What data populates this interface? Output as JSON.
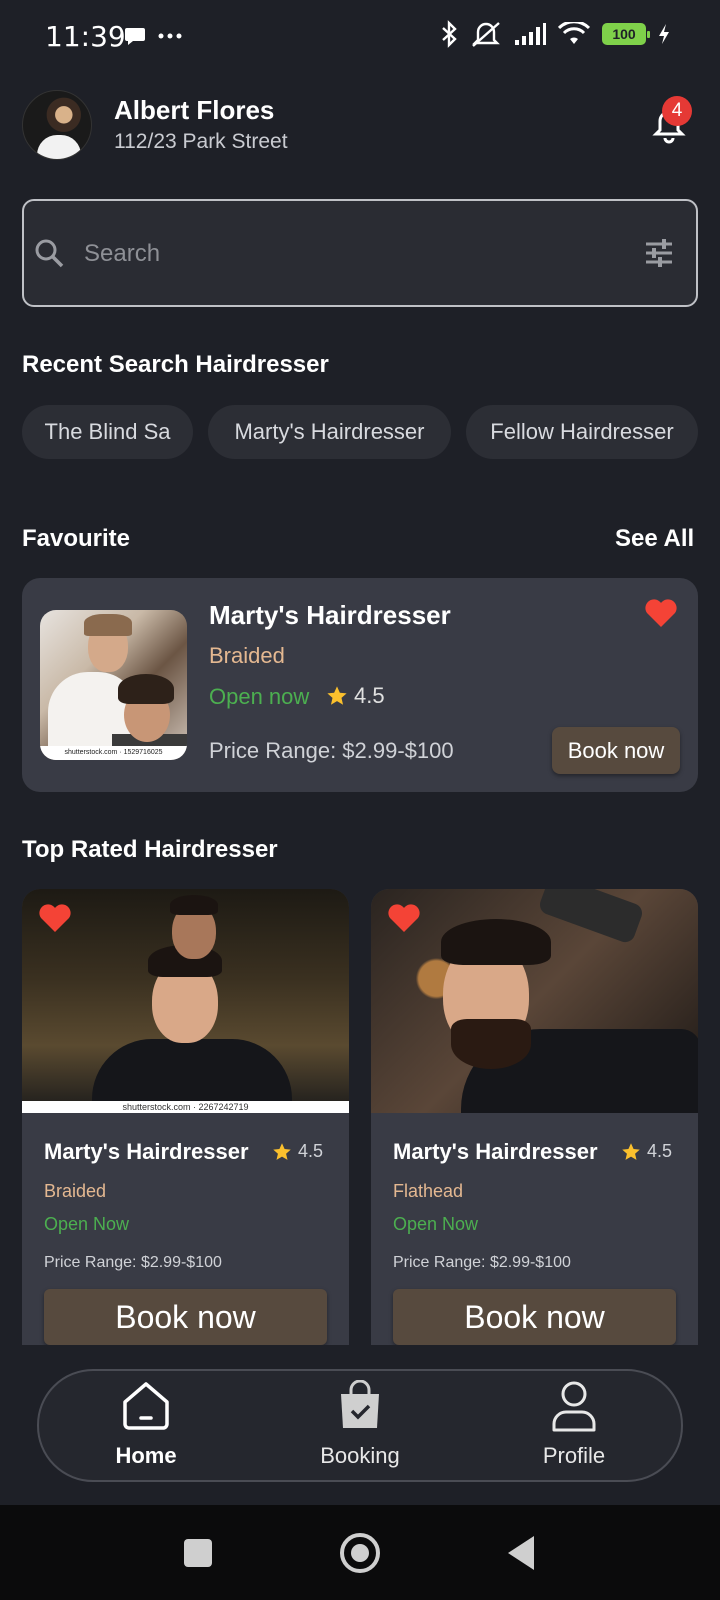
{
  "status_bar": {
    "time": "11:39",
    "battery": "100"
  },
  "header": {
    "user_name": "Albert Flores",
    "address": "112/23 Park Street",
    "notification_count": "4"
  },
  "search": {
    "placeholder": "Search"
  },
  "recent_search": {
    "title": "Recent Search Hairdresser",
    "chips": [
      "The Blind Sa",
      "Marty's Hairdresser",
      "Fellow Hairdresser"
    ]
  },
  "favourite": {
    "title": "Favourite",
    "see_all": "See All",
    "card": {
      "name": "Marty's Hairdresser",
      "style": "Braided",
      "status": "Open now",
      "rating": "4.5",
      "price": "Price Range: $2.99-$100",
      "book_label": "Book now",
      "watermark": "shutterstock.com · 1529716025"
    }
  },
  "top_rated": {
    "title": "Top Rated Hairdresser",
    "cards": [
      {
        "name": "Marty's Hairdresser",
        "rating": "4.5",
        "style": "Braided",
        "status": "Open Now",
        "price": "Price Range: $2.99-$100",
        "book_label": "Book now",
        "watermark": "shutterstock.com · 2267242719"
      },
      {
        "name": "Marty's Hairdresser",
        "rating": "4.5",
        "style": "Flathead",
        "status": "Open Now",
        "price": "Price Range: $2.99-$100",
        "book_label": "Book now"
      }
    ]
  },
  "bottom_nav": {
    "items": [
      {
        "label": "Home",
        "icon": "home-icon",
        "active": true
      },
      {
        "label": "Booking",
        "icon": "shopping-bag-icon",
        "active": false
      },
      {
        "label": "Profile",
        "icon": "person-icon",
        "active": false
      }
    ]
  },
  "colors": {
    "background": "#1e2027",
    "card": "#393b45",
    "accent_brown": "#574a3e",
    "open_green": "#4caf50",
    "style_tan": "#e4b891",
    "heart_red": "#f44336",
    "star_yellow": "#fbc02d"
  }
}
